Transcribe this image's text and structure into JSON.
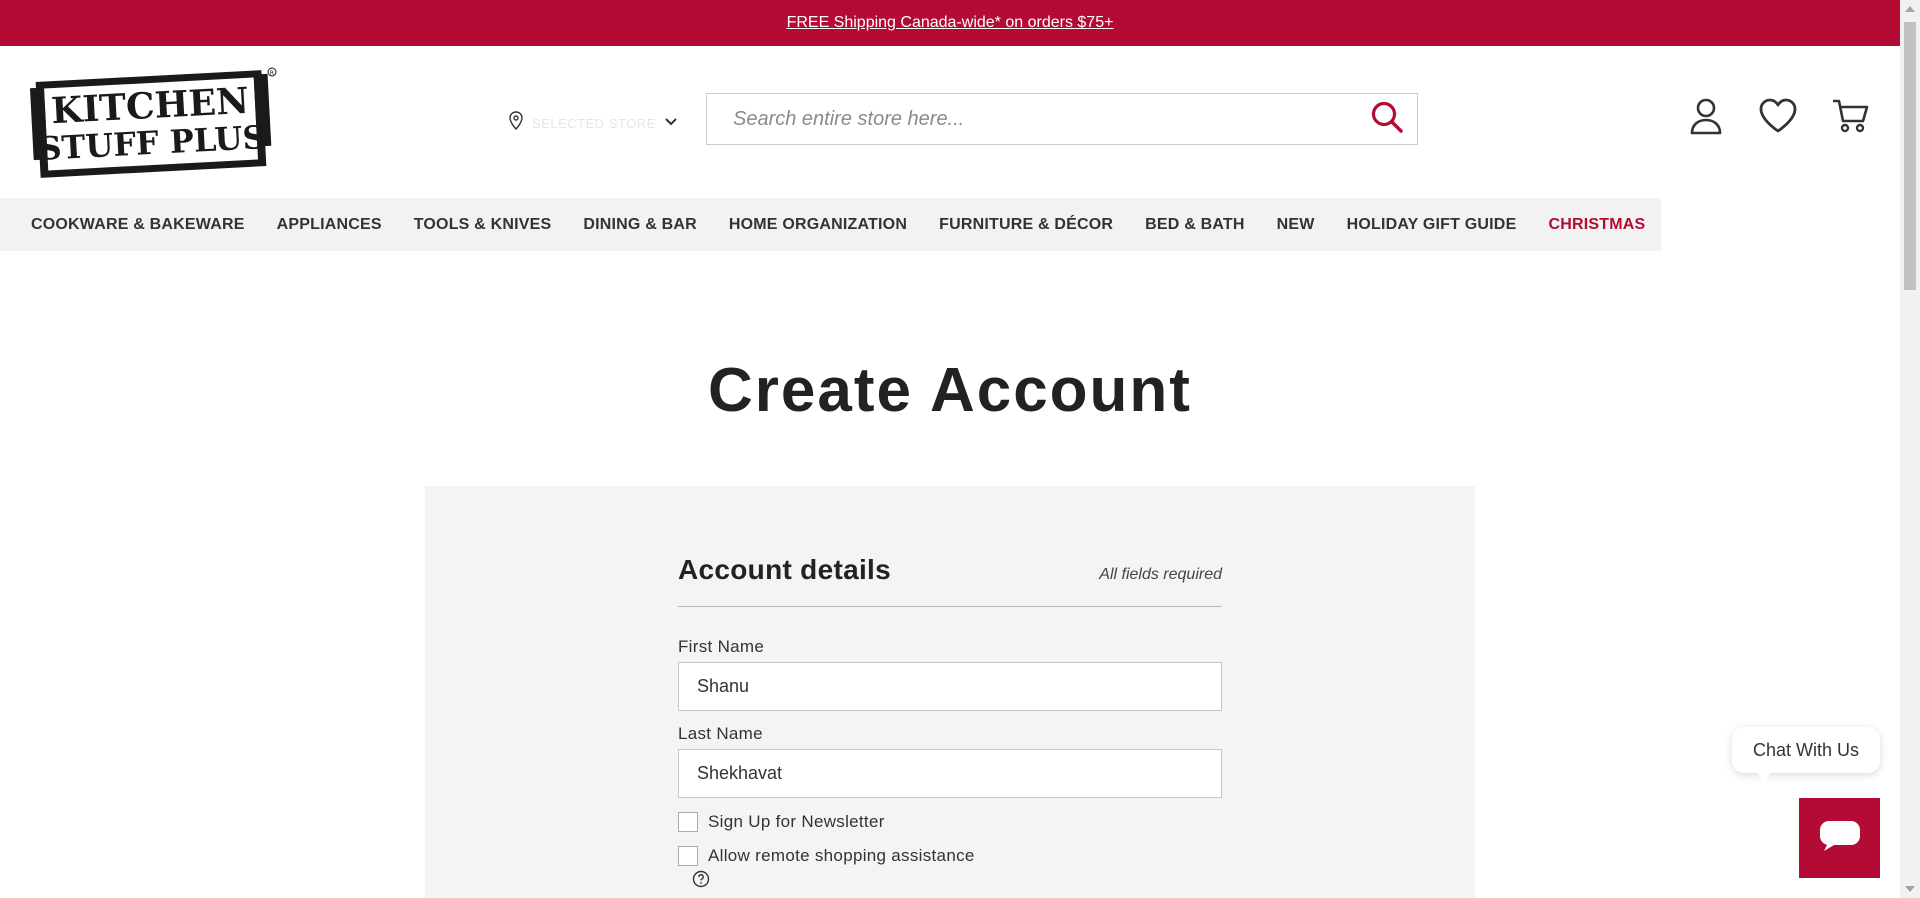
{
  "promo": {
    "text": "FREE Shipping Canada-wide* on orders $75+"
  },
  "header": {
    "logo_alt": "KITCHEN STUFF PLUS",
    "store_label": "SELECTED STORE",
    "search_placeholder": "Search entire store here..."
  },
  "nav": {
    "items": [
      {
        "label": "COOKWARE & BAKEWARE"
      },
      {
        "label": "APPLIANCES"
      },
      {
        "label": "TOOLS & KNIVES"
      },
      {
        "label": "DINING & BAR"
      },
      {
        "label": "HOME ORGANIZATION"
      },
      {
        "label": "FURNITURE & DÉCOR"
      },
      {
        "label": "BED & BATH"
      },
      {
        "label": "NEW"
      },
      {
        "label": "HOLIDAY GIFT GUIDE"
      },
      {
        "label": "CHRISTMAS"
      }
    ]
  },
  "page": {
    "title": "Create Account"
  },
  "form": {
    "section_title": "Account details",
    "required_note": "All fields required",
    "first_name": {
      "label": "First Name",
      "value": "Shanu"
    },
    "last_name": {
      "label": "Last Name",
      "value": "Shekhavat"
    },
    "newsletter_label": "Sign Up for Newsletter",
    "remote_assist_label": "Allow remote shopping assistance"
  },
  "chat": {
    "label": "Chat With Us"
  },
  "colors": {
    "brand": "#b30b33",
    "nav_bg": "#f2f2f2",
    "panel_bg": "#f4f4f4"
  }
}
